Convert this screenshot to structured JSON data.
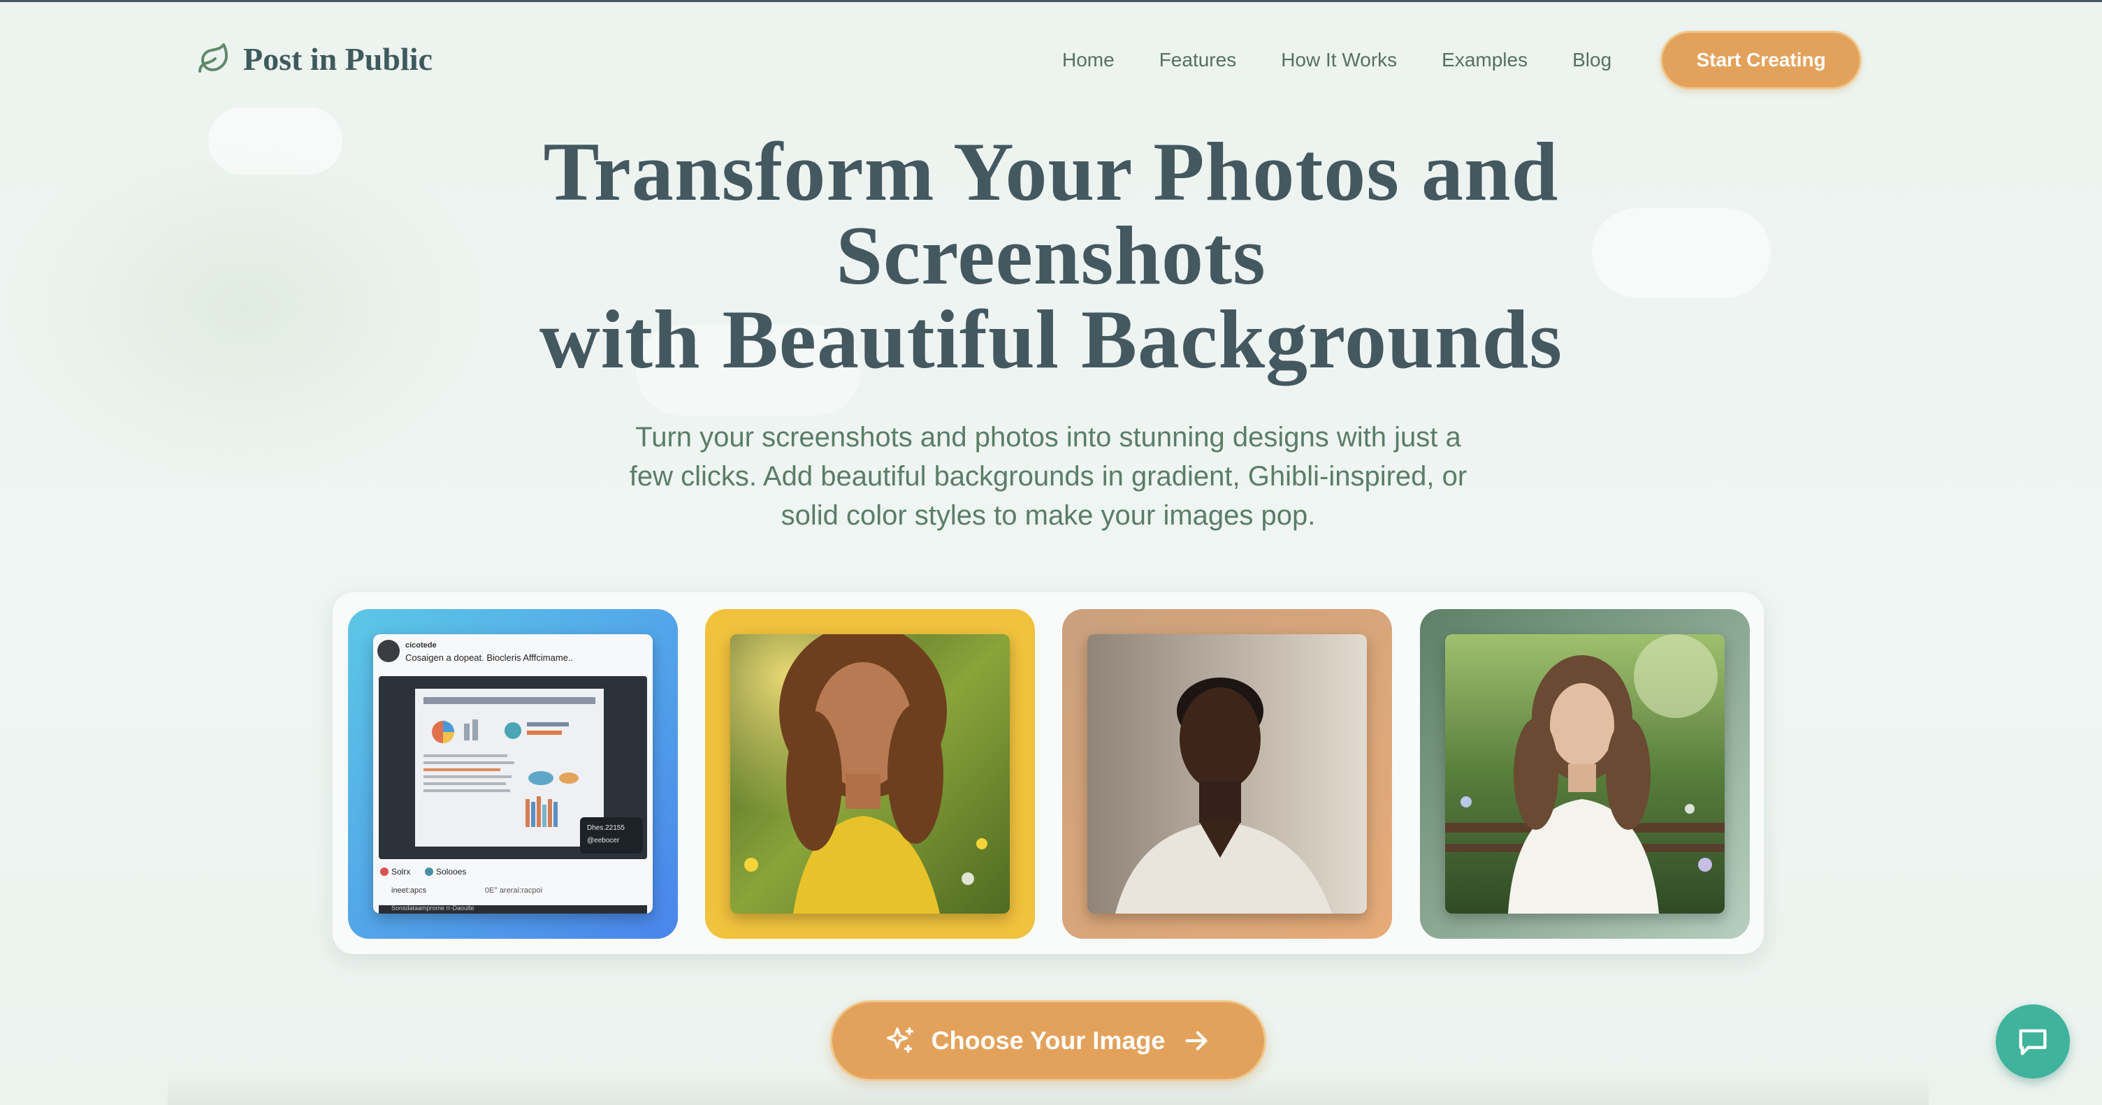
{
  "brand": {
    "name": "Post in Public",
    "icon": "leaf-icon"
  },
  "nav": {
    "links": [
      "Home",
      "Features",
      "How It Works",
      "Examples",
      "Blog"
    ],
    "cta_label": "Start Creating"
  },
  "hero": {
    "title_lines": [
      "Transform Your Photos and",
      "Screenshots",
      "with Beautiful Backgrounds"
    ],
    "subtitle_lines": [
      "Turn your screenshots and photos into stunning designs with just a",
      "few clicks. Add beautiful backgrounds in gradient, Ghibli-inspired, or",
      "solid color styles to make your images pop."
    ]
  },
  "examples": {
    "card1": {
      "background": "blue-gradient",
      "post_user": "cicotede",
      "post_text": "Cosaigen a dopeat. Biocleris Afffcimame..",
      "overlay_line1": "Dhes.22155",
      "overlay_line2": "@eebocer",
      "reaction_a": "Solrx",
      "reaction_b": "Solooes",
      "footer_a": "ineet:apcs",
      "footer_b": "0E° arerai:racpoi",
      "footer_c": "Sonsdataamprome rr-Daoulte"
    },
    "card2": {
      "background": "#f0c23d",
      "subject": "woman in yellow dress in flower field"
    },
    "card3": {
      "background": "peach-gradient",
      "subject": "man in white shirt portrait"
    },
    "card4": {
      "background": "green-gradient",
      "subject": "woman on park bench"
    }
  },
  "cta": {
    "label": "Choose Your Image",
    "icon_left": "sparkles-icon",
    "icon_right": "arrow-right-icon"
  },
  "chat": {
    "icon": "chat-bubble-icon"
  },
  "colors": {
    "accent": "#e3a25c",
    "heading": "#44585f",
    "body_text": "#5a7d67",
    "chat": "#3fb39c"
  }
}
